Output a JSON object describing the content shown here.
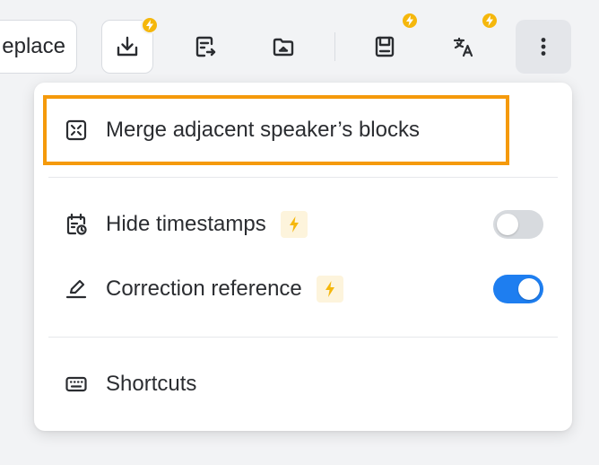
{
  "toolbar": {
    "replace_label": "eplace",
    "buttons": [
      {
        "name": "download",
        "icon": "download-icon",
        "badge": true
      },
      {
        "name": "export-transcript",
        "icon": "document-export-icon",
        "badge": false
      },
      {
        "name": "folder",
        "icon": "folder-icon",
        "badge": false
      },
      {
        "name": "save",
        "icon": "bookmark-save-icon",
        "badge": true
      },
      {
        "name": "translate",
        "icon": "translate-icon",
        "badge": true
      },
      {
        "name": "more",
        "icon": "more-vertical-icon",
        "badge": false,
        "active": true
      }
    ],
    "badge_color": "#f5b70c"
  },
  "menu": {
    "items": [
      {
        "label": "Merge adjacent speaker’s blocks",
        "icon": "merge-blocks-icon"
      },
      {
        "label": "Hide timestamps",
        "icon": "calendar-clock-icon",
        "pro": true,
        "toggle": "off"
      },
      {
        "label": "Correction reference",
        "icon": "pencil-underline-icon",
        "pro": true,
        "toggle": "on"
      },
      {
        "label": "Shortcuts",
        "icon": "keyboard-icon"
      }
    ],
    "highlight_color": "#f59a0b",
    "toggle_on_color": "#1e7ef0"
  }
}
